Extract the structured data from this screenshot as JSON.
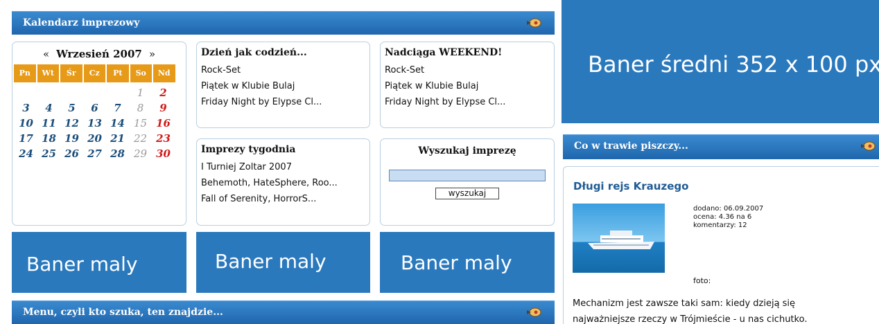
{
  "calendar_panel": {
    "title": "Kalendarz imprezowy",
    "prev": "«",
    "next": "»",
    "month_label": "Wrzesień 2007",
    "dow": [
      "Pn",
      "Wt",
      "Śr",
      "Cz",
      "Pt",
      "So",
      "Nd"
    ],
    "weeks": [
      [
        "",
        "",
        "",
        "",
        "",
        "1",
        "2"
      ],
      [
        "3",
        "4",
        "5",
        "6",
        "7",
        "8",
        "9"
      ],
      [
        "10",
        "11",
        "12",
        "13",
        "14",
        "15",
        "16"
      ],
      [
        "17",
        "18",
        "19",
        "20",
        "21",
        "22",
        "23"
      ],
      [
        "24",
        "25",
        "26",
        "27",
        "28",
        "29",
        "30"
      ]
    ]
  },
  "daily": {
    "title": "Dzień jak codzień...",
    "items": [
      "Rock-Set",
      "Piątek w Klubie Bulaj",
      "Friday Night by Elypse Cl..."
    ]
  },
  "weekend": {
    "title": "Nadciąga WEEKEND!",
    "items": [
      "Rock-Set",
      "Piątek w Klubie Bulaj",
      "Friday Night by Elypse Cl..."
    ]
  },
  "weekly": {
    "title": "Imprezy tygodnia",
    "items": [
      "I Turniej Zoltar 2007",
      "Behemoth, HateSphere, Roo...",
      "Fall of Serenity, HorrorS..."
    ]
  },
  "search": {
    "title": "Wyszukaj imprezę",
    "button": "wyszukaj",
    "value": ""
  },
  "small_banners": [
    "Baner maly",
    "Baner maly",
    "Baner maly"
  ],
  "medium_banner": "Baner średni 352 x 100 px",
  "menu_bar": {
    "title": "Menu, czyli kto szuka, ten znajdzie..."
  },
  "gossip": {
    "title": "Co w trawie piszczy...",
    "article_title": "Długi rejs Krauzego",
    "added": "dodano: 06.09.2007",
    "rating": "ocena: 4.36 na 6",
    "comments": "komentarzy: 12",
    "photo_label": "foto:",
    "text_lines": [
      "Mechanizm jest zawsze taki sam: kiedy dzieją się",
      "najważniejsze rzeczy w Trójmieście - u nas cichutko."
    ]
  },
  "colors": {
    "bar": "#2b79bd",
    "orange": "#e69a18",
    "sunday": "#d11a1a"
  }
}
